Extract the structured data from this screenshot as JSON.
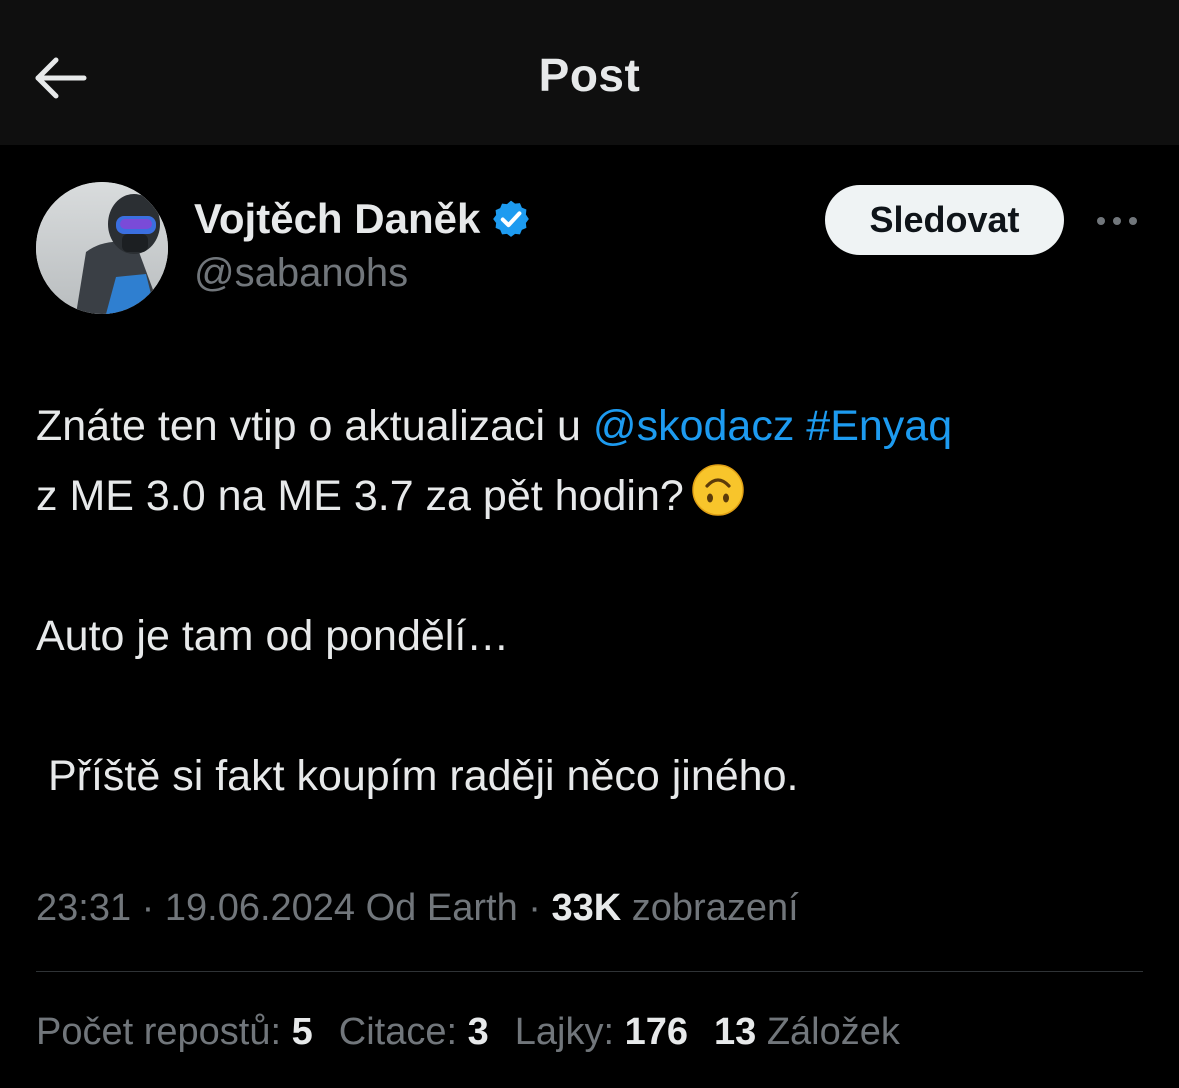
{
  "header": {
    "title": "Post",
    "back_icon": "arrow-left-icon"
  },
  "author": {
    "name": "Vojtěch Daněk",
    "handle": "@sabanohs",
    "verified": true,
    "verified_color": "#1d9bf0"
  },
  "actions": {
    "follow_label": "Sledovat",
    "more_icon": "more-horizontal-icon"
  },
  "post": {
    "line1_prefix": "Znáte ten vtip o aktualizaci u ",
    "mention": "@skodacz",
    "hashtag": "#Enyaq",
    "line2": "z ME 3.0 na ME 3.7 za pět hodin?",
    "emoji": "upside-down-face-emoji",
    "line3": "Auto je tam od pondělí…",
    "line4": " Příště si fakt koupím raději něco jiného."
  },
  "meta": {
    "time": "23:31",
    "separator": " · ",
    "date": "19.06.2024",
    "source": "Od Earth",
    "views_count": "33K",
    "views_label": "zobrazení"
  },
  "stats": {
    "reposts_label": "Počet repostů:",
    "reposts": "5",
    "quotes_label": "Citace:",
    "quotes": "3",
    "likes_label": "Lajky:",
    "likes": "176",
    "bookmarks": "13",
    "bookmarks_label": "Záložek"
  },
  "colors": {
    "background": "#000000",
    "header_bg": "#0f0f0f",
    "text": "#e7e9ea",
    "muted": "#71767b",
    "link": "#1d9bf0"
  }
}
